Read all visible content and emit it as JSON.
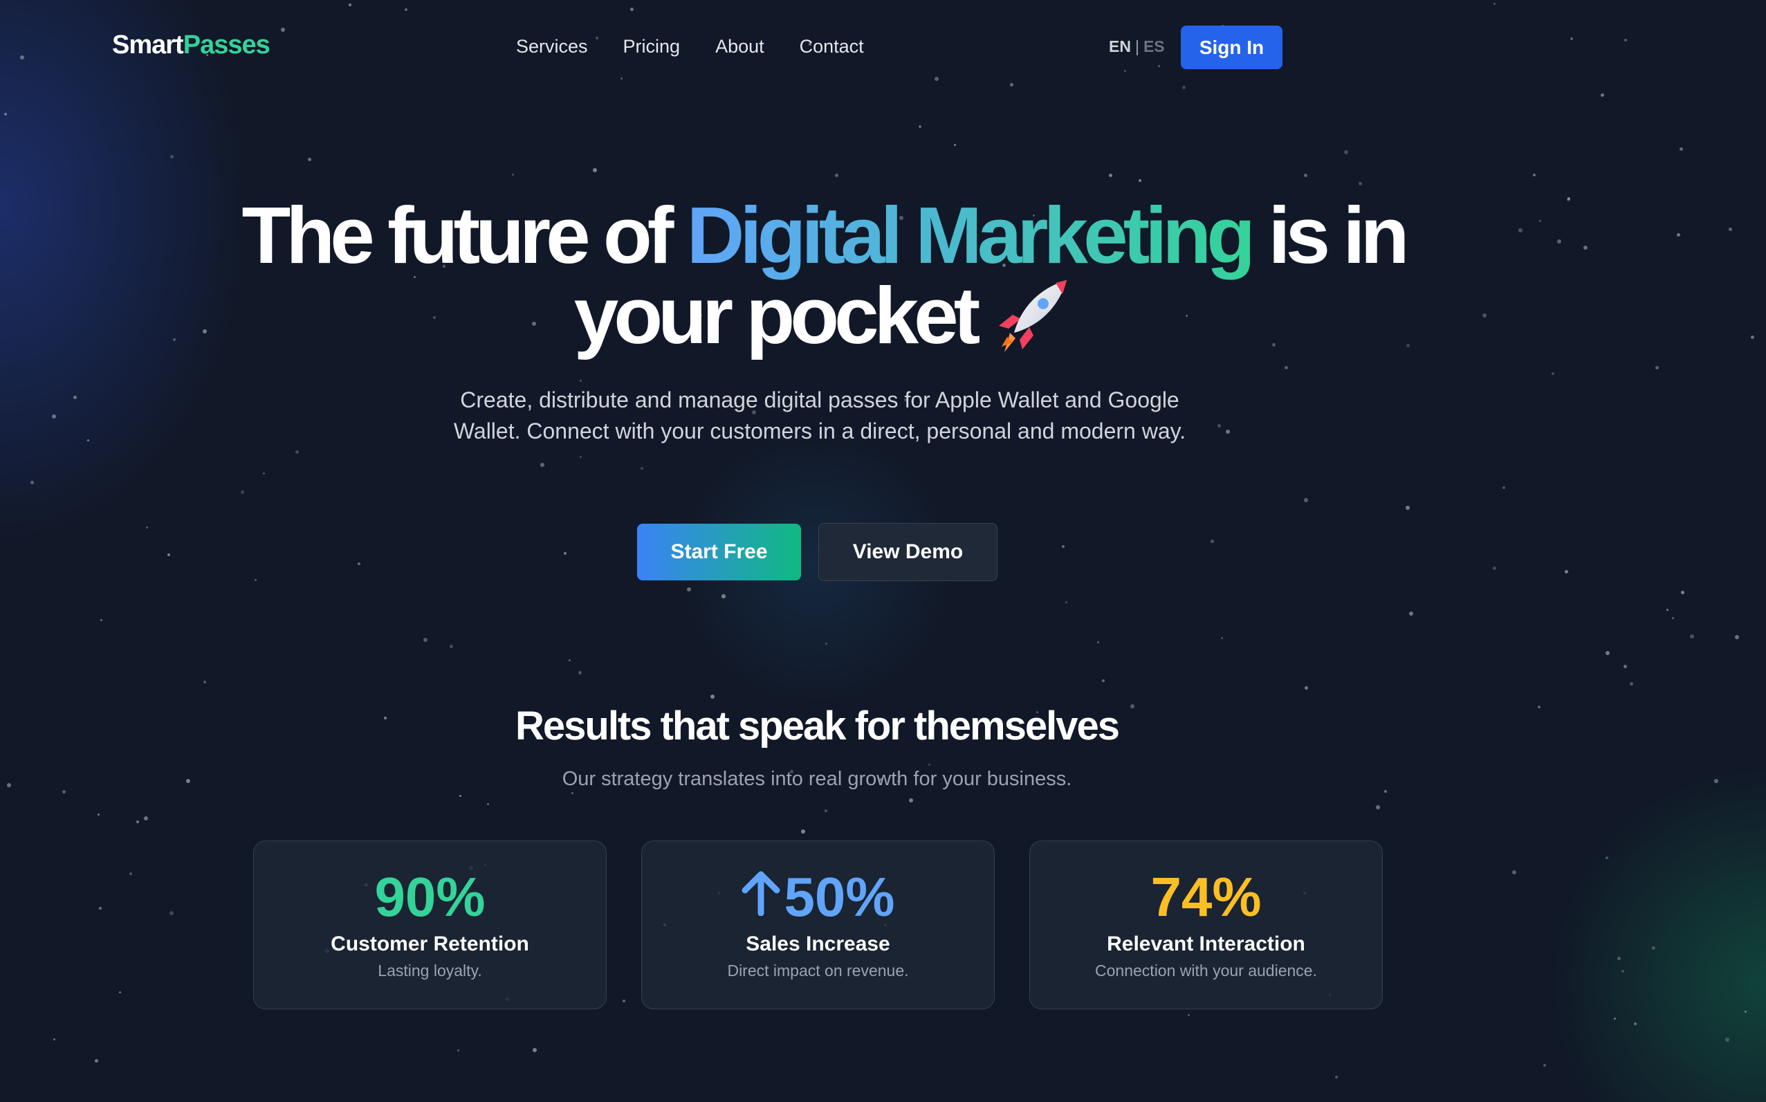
{
  "colors": {
    "background": "#111827",
    "accent_blue": "#2563eb",
    "brand_green": "#34d399",
    "stat_green": "#34d399",
    "stat_blue": "#60a5fa",
    "stat_yellow": "#fbbf24"
  },
  "nav": {
    "logo_part1": "Smart",
    "logo_part2": "Passes",
    "links": [
      "Services",
      "Pricing",
      "About",
      "Contact"
    ],
    "lang_en": "EN",
    "lang_sep": "|",
    "lang_es": "ES",
    "signin_label": "Sign In"
  },
  "hero": {
    "headline_part1": "The future of ",
    "headline_highlight": "Digital Marketing",
    "headline_part2": " is in",
    "headline_line2": "your pocket",
    "rocket_icon": "rocket-icon",
    "subtitle": "Create, distribute and manage digital passes for Apple Wallet and Google Wallet. Connect with your customers in a direct, personal and modern way.",
    "start_label": "Start Free",
    "demo_label": "View Demo"
  },
  "results": {
    "title": "Results that speak for themselves",
    "subtitle": "Our strategy translates into real growth for your business.",
    "cards": [
      {
        "value": "90%",
        "label": "Customer Retention",
        "desc": "Lasting loyalty.",
        "color": "#34d399"
      },
      {
        "value": "50%",
        "icon": "arrow-up-icon",
        "label": "Sales Increase",
        "desc": "Direct impact on revenue.",
        "color": "#60a5fa"
      },
      {
        "value": "74%",
        "label": "Relevant Interaction",
        "desc": "Connection with your audience.",
        "color": "#fbbf24"
      }
    ]
  }
}
